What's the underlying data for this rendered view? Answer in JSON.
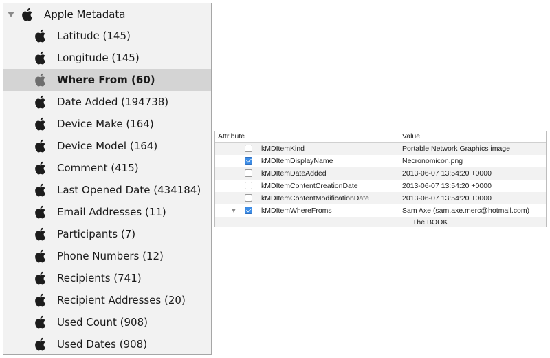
{
  "sidebar": {
    "header": {
      "label": "Apple Metadata",
      "icon": "apple-icon"
    },
    "items": [
      {
        "label": "Latitude (145)"
      },
      {
        "label": "Longitude (145)"
      },
      {
        "label": "Where From (60)",
        "selected": true
      },
      {
        "label": "Date Added (194738)"
      },
      {
        "label": "Device Make (164)"
      },
      {
        "label": "Device Model (164)"
      },
      {
        "label": "Comment (415)"
      },
      {
        "label": "Last Opened Date (434184)"
      },
      {
        "label": "Email Addresses (11)"
      },
      {
        "label": "Participants (7)"
      },
      {
        "label": "Phone Numbers (12)"
      },
      {
        "label": "Recipients (741)"
      },
      {
        "label": "Recipient Addresses (20)"
      },
      {
        "label": "Used Count (908)"
      },
      {
        "label": "Used Dates (908)"
      }
    ]
  },
  "table": {
    "columns": {
      "attribute": "Attribute",
      "value": "Value"
    },
    "rows": [
      {
        "name": "kMDItemKind",
        "value": "Portable Network Graphics image",
        "checked": false
      },
      {
        "name": "kMDItemDisplayName",
        "value": "Necronomicon.png",
        "checked": true
      },
      {
        "name": "kMDItemDateAdded",
        "value": "2013-06-07 13:54:20 +0000",
        "checked": false
      },
      {
        "name": "kMDItemContentCreationDate",
        "value": "2013-06-07 13:54:20 +0000",
        "checked": false
      },
      {
        "name": "kMDItemContentModificationDate",
        "value": "2013-06-07 13:54:20 +0000",
        "checked": false
      },
      {
        "name": "kMDItemWhereFroms",
        "value": "Sam Axe (sam.axe.merc@hotmail.com)",
        "checked": true,
        "expanded": true,
        "children": [
          "The BOOK"
        ]
      }
    ]
  },
  "colors": {
    "selection": "#d4d4d4",
    "checkbox_accent": "#3d8de6"
  }
}
